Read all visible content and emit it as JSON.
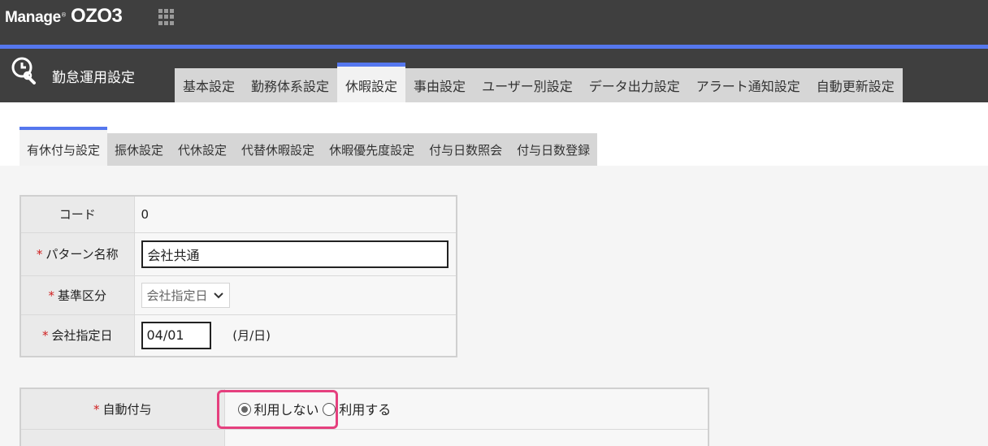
{
  "brand": {
    "prefix": "Manage",
    "name": "OZO3"
  },
  "header": {
    "title": "勤怠運用設定"
  },
  "main_tabs": [
    {
      "label": "基本設定",
      "active": false
    },
    {
      "label": "勤務体系設定",
      "active": false
    },
    {
      "label": "休暇設定",
      "active": true
    },
    {
      "label": "事由設定",
      "active": false
    },
    {
      "label": "ユーザー別設定",
      "active": false
    },
    {
      "label": "データ出力設定",
      "active": false
    },
    {
      "label": "アラート通知設定",
      "active": false
    },
    {
      "label": "自動更新設定",
      "active": false
    }
  ],
  "sub_tabs": [
    {
      "label": "有休付与設定",
      "active": true
    },
    {
      "label": "振休設定",
      "active": false
    },
    {
      "label": "代休設定",
      "active": false
    },
    {
      "label": "代替休暇設定",
      "active": false
    },
    {
      "label": "休暇優先度設定",
      "active": false
    },
    {
      "label": "付与日数照会",
      "active": false
    },
    {
      "label": "付与日数登録",
      "active": false
    }
  ],
  "form": {
    "required_mark": "*",
    "code": {
      "label": "コード",
      "value": "0"
    },
    "pattern_name": {
      "label": "パターン名称",
      "value": "会社共通"
    },
    "base_category": {
      "label": "基準区分",
      "value": "会社指定日"
    },
    "company_date": {
      "label": "会社指定日",
      "value": "04/01",
      "unit": "(月/日)"
    }
  },
  "auto_grant": {
    "label": "自動付与",
    "options": [
      {
        "label": "利用しない",
        "checked": true
      },
      {
        "label": "利用する",
        "checked": false
      }
    ]
  },
  "colors": {
    "accent": "#5577ee",
    "header_bg": "#3f3f3f",
    "highlight": "#e5407e",
    "required": "#d02020"
  }
}
